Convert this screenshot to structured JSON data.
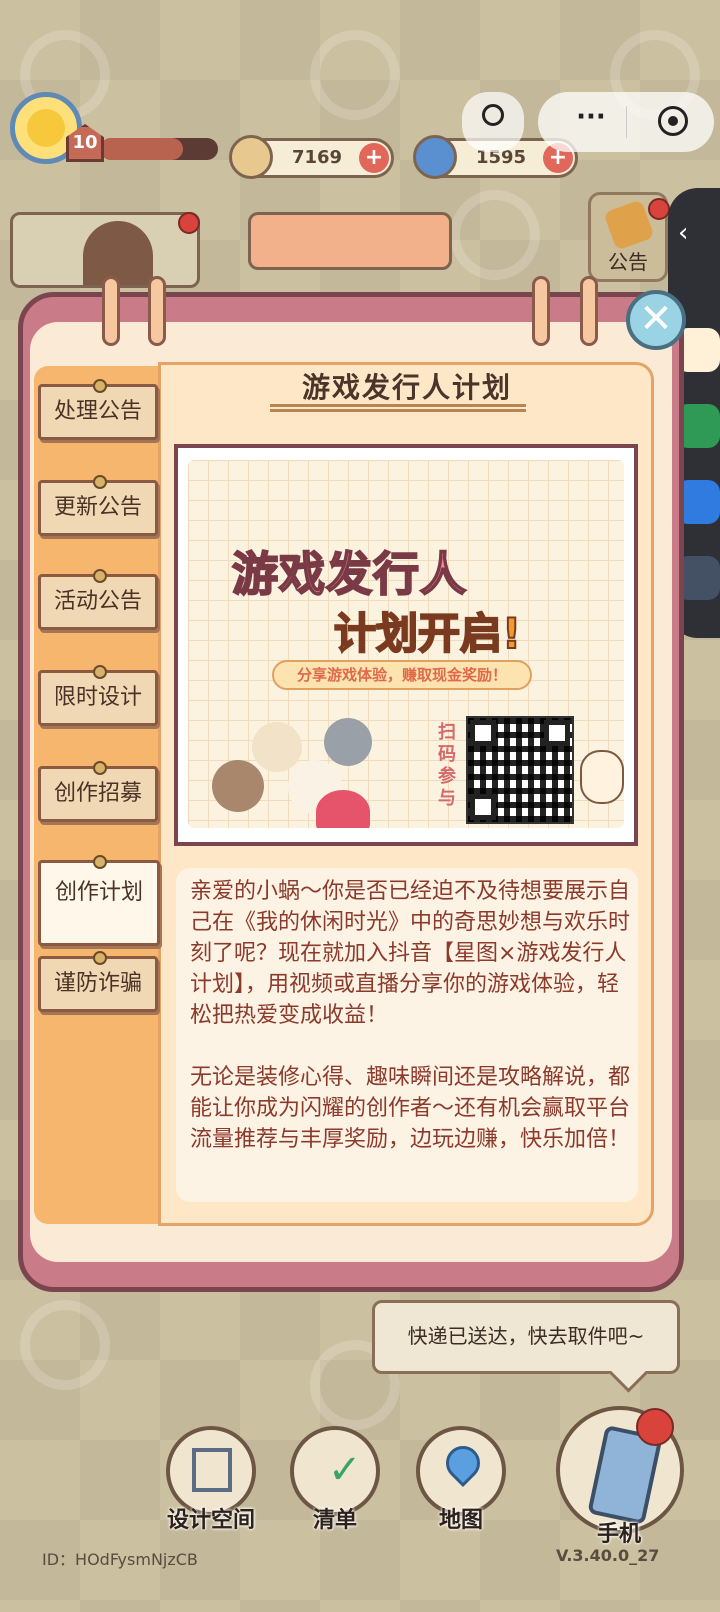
{
  "hud": {
    "level": "10",
    "level_progress": 0.7,
    "coins": "7169",
    "gems": "1595",
    "plus": "+",
    "menu_dots": "···"
  },
  "notice_button": {
    "label": "公告"
  },
  "panel": {
    "title": "游戏发行人计划",
    "close": "✕",
    "tabs": [
      {
        "label": "处理公告"
      },
      {
        "label": "更新公告"
      },
      {
        "label": "活动公告"
      },
      {
        "label": "限时设计"
      },
      {
        "label": "创作招募"
      },
      {
        "label": "创作计划",
        "active": true
      },
      {
        "label": "谨防诈骗"
      }
    ],
    "poster": {
      "headline": "游戏发行人",
      "subheadline": "计划开启!",
      "pill": "分享游戏体验，赚取现金奖励！",
      "scan": "扫码参与"
    },
    "paragraphs": [
      "亲爱的小蜗～你是否已经迫不及待想要展示自己在《我的休闲时光》中的奇思妙想与欢乐时刻了呢？现在就加入抖音【星图×游戏发行人计划】，用视频或直播分享你的游戏体验，轻松把热爱变成收益！",
      "无论是装修心得、趣味瞬间还是攻略解说，都能让你成为闪耀的创作者～还有机会赢取平台流量推荐与丰厚奖励，边玩边赚，快乐加倍！"
    ]
  },
  "toast": "快递已送达，快去取件吧~",
  "nav": [
    {
      "label": "设计空间"
    },
    {
      "label": "清单"
    },
    {
      "label": "地图"
    },
    {
      "label": "手机"
    }
  ],
  "footer": {
    "id": "ID：HOdFysmNjzCB",
    "version": "V.3.40.0_27"
  },
  "colors": {
    "panel_border": "#c97b87",
    "tab_strip": "#f6b66d",
    "text_brown": "#8b3a2c",
    "accent_red": "#d8433c"
  }
}
